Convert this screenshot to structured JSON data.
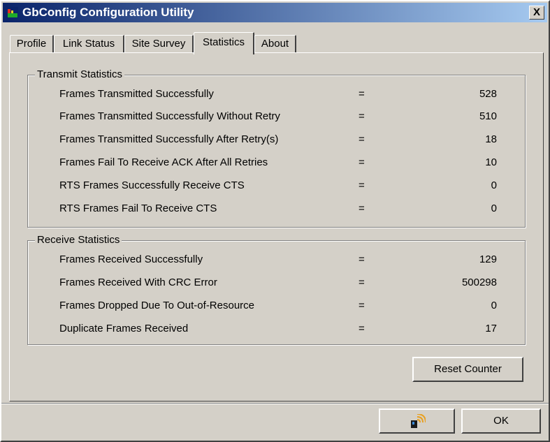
{
  "window": {
    "title": "GbConfig Configuration Utility",
    "close_label": "X"
  },
  "tabs": [
    {
      "label": "Profile"
    },
    {
      "label": "Link Status"
    },
    {
      "label": "Site Survey"
    },
    {
      "label": "Statistics"
    },
    {
      "label": "About"
    }
  ],
  "active_tab": "Statistics",
  "transmit": {
    "title": "Transmit Statistics",
    "rows": [
      {
        "label": "Frames Transmitted Successfully",
        "eq": "=",
        "value": "528"
      },
      {
        "label": "Frames Transmitted Successfully  Without Retry",
        "eq": "=",
        "value": "510"
      },
      {
        "label": "Frames Transmitted Successfully After Retry(s)",
        "eq": "=",
        "value": "18"
      },
      {
        "label": "Frames Fail To Receive ACK After All Retries",
        "eq": "=",
        "value": "10"
      },
      {
        "label": "RTS Frames Successfully Receive CTS",
        "eq": "=",
        "value": "0"
      },
      {
        "label": "RTS Frames Fail To Receive CTS",
        "eq": "=",
        "value": "0"
      }
    ]
  },
  "receive": {
    "title": "Receive Statistics",
    "rows": [
      {
        "label": "Frames Received Successfully",
        "eq": "=",
        "value": "129"
      },
      {
        "label": "Frames Received With CRC Error",
        "eq": "=",
        "value": "500298"
      },
      {
        "label": "Frames Dropped Due To Out-of-Resource",
        "eq": "=",
        "value": "0"
      },
      {
        "label": "Duplicate Frames Received",
        "eq": "=",
        "value": "17"
      }
    ]
  },
  "buttons": {
    "reset_counter": "Reset Counter",
    "ok": "OK",
    "tray_icon": "wireless-card-icon"
  },
  "colors": {
    "face": "#d4d0c8",
    "title_start": "#0a246a",
    "title_end": "#a6caf0"
  }
}
